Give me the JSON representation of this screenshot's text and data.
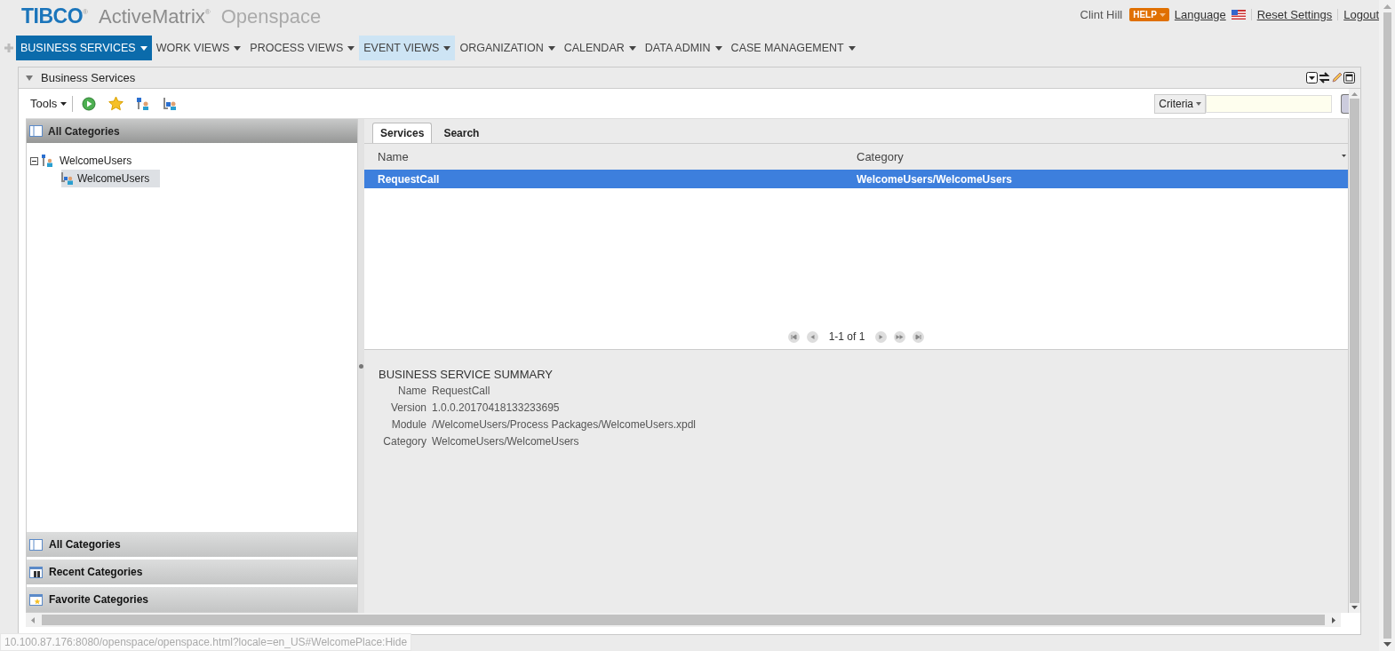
{
  "header": {
    "logo": "TIBCO",
    "logo_mark": "®",
    "product": "ActiveMatrix",
    "product_mark": "®",
    "app": "Openspace",
    "user": "Clint Hill",
    "help": "HELP",
    "language": "Language",
    "links": [
      "Reset Settings",
      "Logout"
    ]
  },
  "nav": [
    {
      "label": "BUSINESS SERVICES",
      "selected": true,
      "highlighted": false
    },
    {
      "label": "WORK VIEWS",
      "selected": false,
      "highlighted": false
    },
    {
      "label": "PROCESS VIEWS",
      "selected": false,
      "highlighted": false
    },
    {
      "label": "EVENT VIEWS",
      "selected": false,
      "highlighted": true
    },
    {
      "label": "ORGANIZATION",
      "selected": false,
      "highlighted": false
    },
    {
      "label": "CALENDAR",
      "selected": false,
      "highlighted": false
    },
    {
      "label": "DATA ADMIN",
      "selected": false,
      "highlighted": false
    },
    {
      "label": "CASE MANAGEMENT",
      "selected": false,
      "highlighted": false
    }
  ],
  "panel": {
    "title": "Business Services",
    "tools": "Tools",
    "criteria": "Criteria"
  },
  "categories": {
    "title": "All Categories",
    "tree": [
      {
        "label": "WelcomeUsers",
        "expanded": true,
        "selected": false,
        "children": [
          {
            "label": "WelcomeUsers",
            "selected": true
          }
        ]
      }
    ],
    "accordion": [
      {
        "label": "All Categories",
        "kind": "tree"
      },
      {
        "label": "Recent Categories",
        "kind": "recent"
      },
      {
        "label": "Favorite Categories",
        "kind": "favorite"
      }
    ]
  },
  "services": {
    "tabs": [
      {
        "label": "Services",
        "selected": true
      },
      {
        "label": "Search",
        "selected": false
      }
    ],
    "columns": [
      "Name",
      "Category"
    ],
    "rows": [
      {
        "cells": [
          "RequestCall",
          "WelcomeUsers/WelcomeUsers"
        ],
        "selected": true
      }
    ],
    "pager": "1-1 of 1",
    "summary": {
      "title": "BUSINESS SERVICE SUMMARY",
      "fields": [
        {
          "label": "Name",
          "value": "RequestCall"
        },
        {
          "label": "Version",
          "value": "1.0.0.20170418133233695"
        },
        {
          "label": "Module",
          "value": "/WelcomeUsers/Process Packages/WelcomeUsers.xpdl"
        },
        {
          "label": "Category",
          "value": "WelcomeUsers/WelcomeUsers"
        }
      ]
    }
  },
  "status_url": "10.100.87.176:8080/openspace/openspace.html?locale=en_US#WelcomePlace:Hide"
}
